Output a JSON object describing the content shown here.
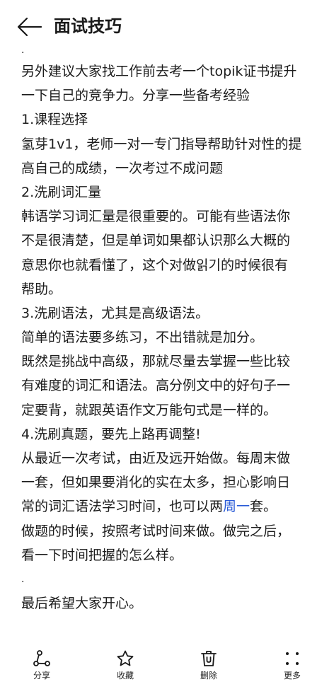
{
  "header": {
    "title": "面试技巧"
  },
  "content": {
    "top_dot": ".",
    "lines": [
      "另外建议大家找工作前去考一个topik证书提升",
      "一下自己的竞争力。分享一些备考经验",
      "1.课程选择",
      "氢芽1v1，老师一对一专门指导帮助针对性的提",
      "高自己的成绩，一次考过不成问题",
      "2.洗刷词汇量",
      "韩语学习词汇量是很重要的。可能有些语法你",
      "不是很清楚，但是单词如果都认识那么大概的",
      "意思你也就看懂了，这个对做읽기的时候很有",
      "帮助。",
      "3.洗刷语法，尤其是高级语法。",
      "简单的语法要多练习，不出错就是加分。",
      "既然是挑战中高级，那就尽量去掌握一些比较",
      "有难度的词汇和语法。高分例文中的好句子一",
      "定要背，就跟英语作文万能句式是一样的。",
      "4.洗刷真题，要先上路再调整!",
      "从最近一次考试，由近及远开始做。每周末做",
      "一套，但如果要消化的实在太多，担心影响日"
    ],
    "link_line": {
      "before": "常的词汇语法学习时间，也可以两",
      "link": "周一",
      "after": "套。"
    },
    "lines_after": [
      "做题的时候，按照考试时间来做。做完之后，",
      "看一下时间把握的怎么样。"
    ],
    "dot": ".",
    "closing": "最后希望大家开心。"
  },
  "toolbar": {
    "items": [
      {
        "label": "分享",
        "icon": "share-icon"
      },
      {
        "label": "收藏",
        "icon": "star-icon"
      },
      {
        "label": "删除",
        "icon": "trash-icon"
      },
      {
        "label": "更多",
        "icon": "more-dots-icon"
      }
    ]
  }
}
